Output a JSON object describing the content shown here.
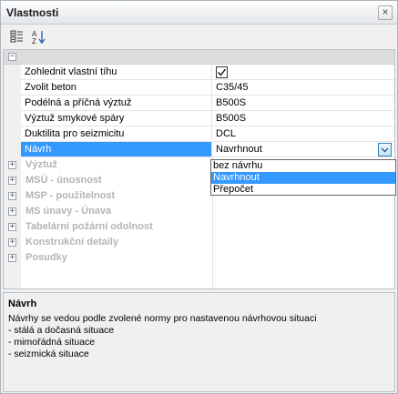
{
  "window": {
    "title": "Vlastnosti",
    "close_glyph": "×"
  },
  "toolbar": {
    "categorized_icon": "categorized-icon",
    "alphabetical_icon": "sort-alpha-icon"
  },
  "group": {
    "expander": "−"
  },
  "rows": [
    {
      "name": "Zohlednit vlastní tíhu",
      "value": "",
      "checked": true
    },
    {
      "name": "Zvolit beton",
      "value": "C35/45"
    },
    {
      "name": "Podélná a příčná výztuž",
      "value": "B500S"
    },
    {
      "name": "Výztuž smykové spáry",
      "value": "B500S"
    },
    {
      "name": "Duktilita pro seizmicitu",
      "value": "DCL"
    },
    {
      "name": "Návrh",
      "value": "Navrhnout",
      "selected": true
    }
  ],
  "categories": [
    {
      "expander": "+",
      "name": "Výztuž"
    },
    {
      "expander": "+",
      "name": "MSÚ - únosnost"
    },
    {
      "expander": "+",
      "name": "MSP - použitelnost"
    },
    {
      "expander": "+",
      "name": "MS únavy - Únava"
    },
    {
      "expander": "+",
      "name": "Tabelární požární odolnost"
    },
    {
      "expander": "+",
      "name": "Konstrukční detaily"
    },
    {
      "expander": "+",
      "name": "Posudky"
    }
  ],
  "dropdown": {
    "options": [
      "bez návrhu",
      "Navrhnout",
      "Přepočet"
    ],
    "selected_index": 1
  },
  "description": {
    "title": "Návrh",
    "lines": [
      "Návrhy se vedou podle zvolené normy pro nastavenou návrhovou situaci",
      "- stálá a dočasná situace",
      "- mimořádná situace",
      "- seizmická situace"
    ]
  },
  "colors": {
    "selection": "#3399ff",
    "category_text": "#b4b4b4",
    "group_header": "#dcdcdc"
  }
}
